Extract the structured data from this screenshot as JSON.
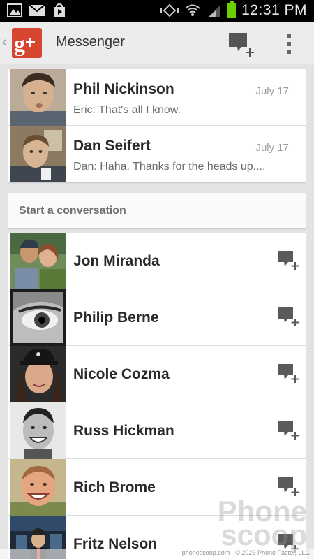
{
  "status_bar": {
    "time": "12:31 PM",
    "icons": [
      "gallery-icon",
      "gmail-icon",
      "play-store-icon",
      "vibrate-icon",
      "wifi-icon",
      "signal-icon",
      "battery-icon"
    ]
  },
  "action_bar": {
    "app_title": "Messenger",
    "logo": "g+"
  },
  "recent_conversations": [
    {
      "name": "Phil Nickinson",
      "date": "July 17",
      "snippet": "Eric: That's all I know."
    },
    {
      "name": "Dan Seifert",
      "date": "July 17",
      "snippet": "Dan: Haha. Thanks for the heads up...."
    }
  ],
  "start_conversation": {
    "label": "Start a conversation",
    "contacts": [
      {
        "name": "Jon Miranda"
      },
      {
        "name": "Philip Berne"
      },
      {
        "name": "Nicole Cozma"
      },
      {
        "name": "Russ Hickman"
      },
      {
        "name": "Rich Brome"
      },
      {
        "name": "Fritz Nelson"
      }
    ]
  },
  "watermark": {
    "line1": "Phone",
    "line2": "scoop"
  },
  "credit": "phonescoop.com · © 2023 Phone Factor, LLC",
  "colors": {
    "gplus_red": "#d6452f",
    "battery_green": "#6cd000",
    "background": "#e3e3e3"
  }
}
